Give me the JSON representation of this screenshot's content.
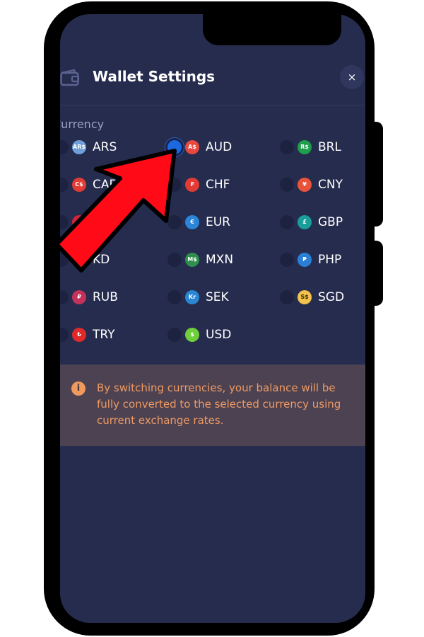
{
  "header": {
    "title": "Wallet Settings",
    "close_label": "×"
  },
  "currency_section": {
    "label": "Currency"
  },
  "currencies": [
    {
      "code": "ARS",
      "symbol": "AR$",
      "color": "#6f9fd8",
      "selected": false
    },
    {
      "code": "AUD",
      "symbol": "A$",
      "color": "#e8483f",
      "selected": true
    },
    {
      "code": "BRL",
      "symbol": "R$",
      "color": "#1f9e4c",
      "selected": false
    },
    {
      "code": "CAD",
      "symbol": "C$",
      "color": "#e23b33",
      "selected": false
    },
    {
      "code": "CHF",
      "symbol": "₣",
      "color": "#e23b33",
      "selected": false
    },
    {
      "code": "CNY",
      "symbol": "¥",
      "color": "#e8533a",
      "selected": false
    },
    {
      "code": "",
      "symbol": "K",
      "color": "#d4243a",
      "selected": false
    },
    {
      "code": "EUR",
      "symbol": "€",
      "color": "#2b86d9",
      "selected": false
    },
    {
      "code": "GBP",
      "symbol": "£",
      "color": "#1a9e9a",
      "selected": false
    },
    {
      "code": "KD",
      "symbol": "",
      "color": "#262c4e",
      "selected": false
    },
    {
      "code": "MXN",
      "symbol": "M$",
      "color": "#2f8f4e",
      "selected": false
    },
    {
      "code": "PHP",
      "symbol": "₱",
      "color": "#2a7fd6",
      "selected": false
    },
    {
      "code": "RUB",
      "symbol": "₽",
      "color": "#c2325a",
      "selected": false
    },
    {
      "code": "SEK",
      "symbol": "Kr",
      "color": "#2b87d4",
      "selected": false
    },
    {
      "code": "SGD",
      "symbol": "S$",
      "color": "#f2c14e",
      "selected": false
    },
    {
      "code": "TRY",
      "symbol": "₺",
      "color": "#e02a2a",
      "selected": false
    },
    {
      "code": "USD",
      "symbol": "$",
      "color": "#6fcf3b",
      "selected": false
    }
  ],
  "notice": {
    "icon": "info-icon",
    "text": "By switching currencies, your balance will be fully converted to the selected currency using current exchange rates."
  },
  "annotation": {
    "icon": "red-pointer-arrow-icon",
    "color": "#ff0a16"
  }
}
